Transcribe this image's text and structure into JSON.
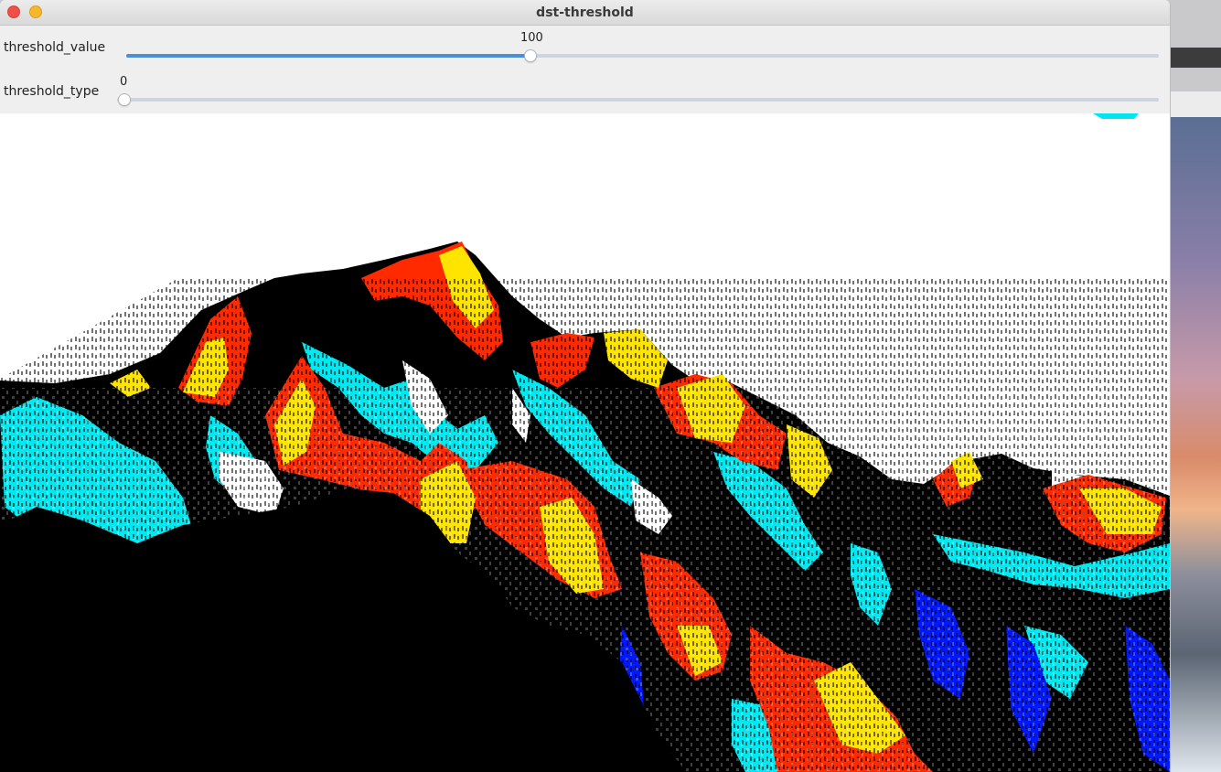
{
  "window": {
    "title": "dst-threshold"
  },
  "trackbars": [
    {
      "name": "threshold_value",
      "value": "100",
      "fraction": 0.392
    },
    {
      "name": "threshold_type",
      "value": "0",
      "fraction": 0.0
    }
  ],
  "image": {
    "description_icon": "thresholded-mountain-image"
  },
  "colors": {
    "slider_fill": "#4a90d9",
    "close": "#ee4f47",
    "minimize": "#f5b72d"
  }
}
